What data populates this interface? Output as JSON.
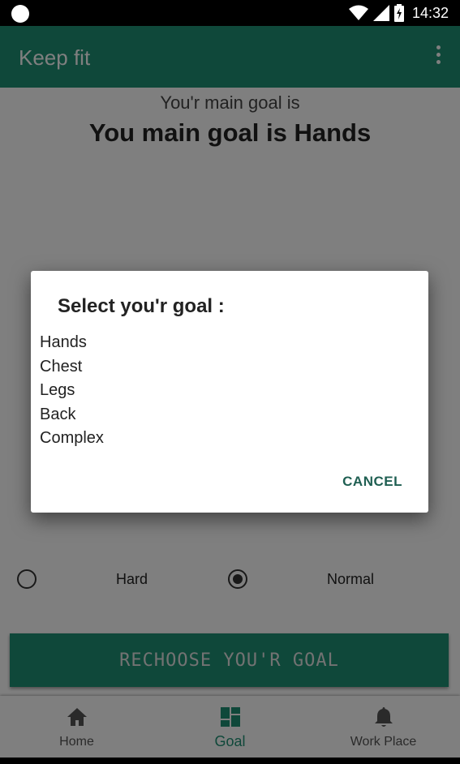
{
  "status_bar": {
    "time": "14:32"
  },
  "app_bar": {
    "title": "Keep fit",
    "overflow_icon": "more-vert-icon"
  },
  "main": {
    "subtitle": "You'r main goal is",
    "headline": "You main goal is Hands",
    "difficulty": {
      "options": [
        {
          "label": "Hard",
          "selected": false
        },
        {
          "label": "Normal",
          "selected": true
        }
      ]
    },
    "rechoose_button_label": "RECHOOSE YOU'R GOAL"
  },
  "bottom_nav": {
    "items": [
      {
        "label": "Home",
        "icon": "home-icon",
        "active": false
      },
      {
        "label": "Goal",
        "icon": "dashboard-icon",
        "active": true
      },
      {
        "label": "Work Place",
        "icon": "bell-icon",
        "active": false
      }
    ]
  },
  "dialog": {
    "title": "Select you'r goal :",
    "options": [
      "Hands",
      "Chest",
      "Legs",
      "Back",
      "Complex"
    ],
    "cancel_label": "CANCEL"
  },
  "colors": {
    "primary": "#1f9174",
    "scrim": "rgba(0,0,0,0.5)",
    "cancel_text": "#1f5f52"
  }
}
